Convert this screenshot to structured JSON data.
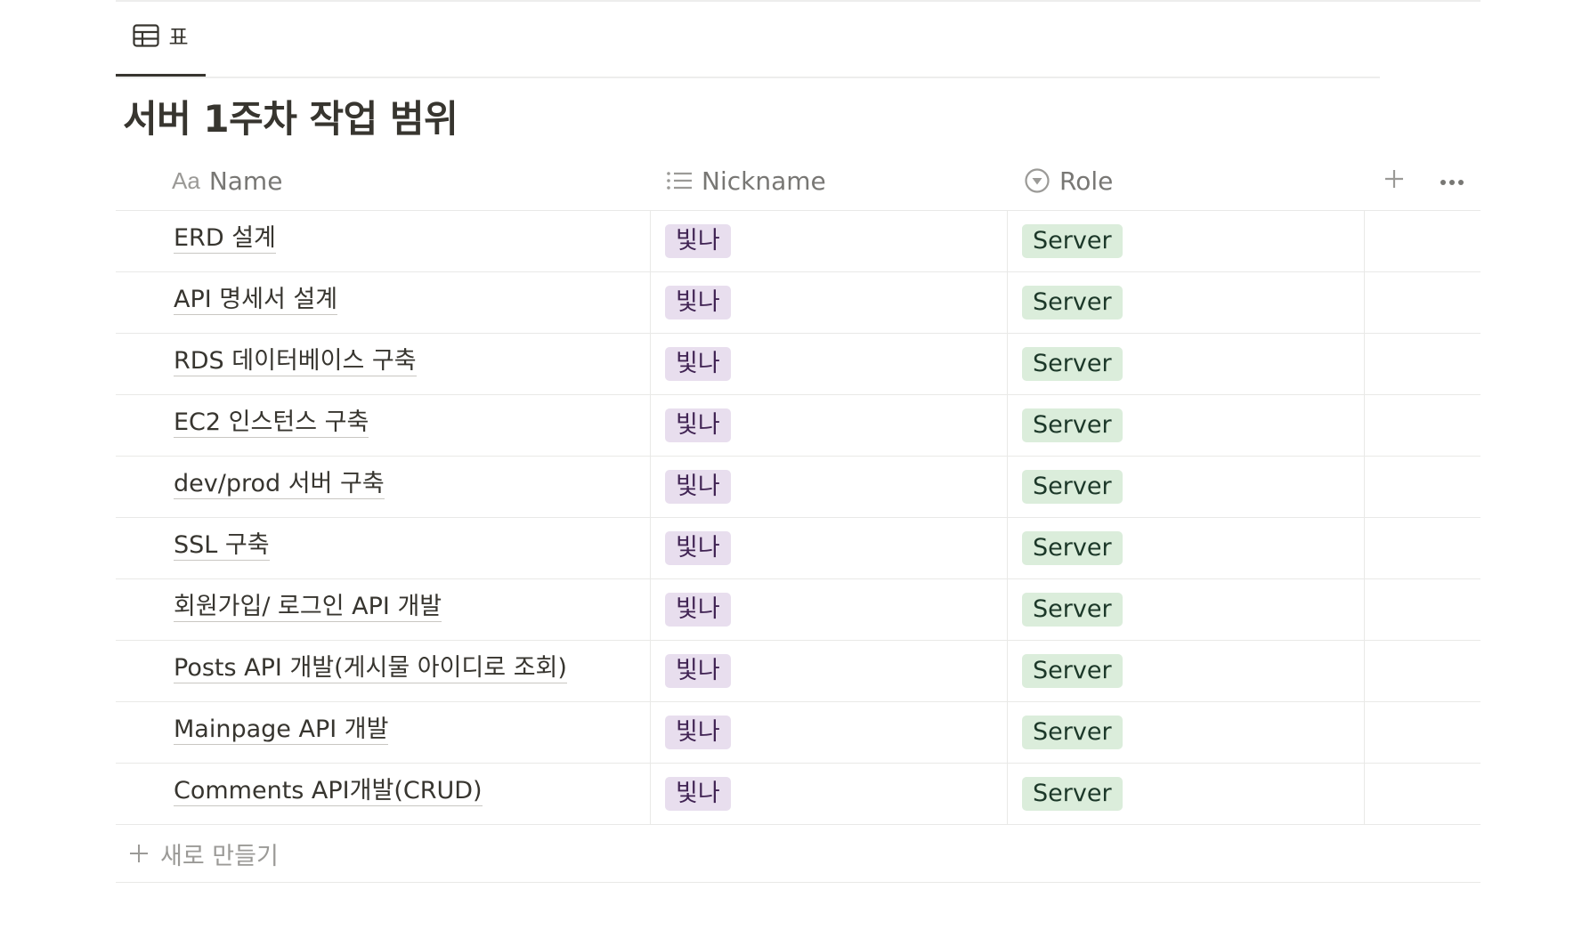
{
  "view": {
    "tab_label": "표",
    "tab_icon": "table-icon"
  },
  "page": {
    "title": "서버 1주차 작업 범위"
  },
  "table": {
    "columns": [
      {
        "label": "Name",
        "icon": "Aa"
      },
      {
        "label": "Nickname",
        "icon": "list-icon"
      },
      {
        "label": "Role",
        "icon": "select-icon"
      }
    ],
    "add_column_icon": "plus-icon",
    "more_icon": "more-icon",
    "rows": [
      {
        "name": "ERD 설계",
        "nickname": "빛나",
        "role": "Server"
      },
      {
        "name": "API 명세서 설계",
        "nickname": "빛나",
        "role": "Server"
      },
      {
        "name": "RDS 데이터베이스 구축",
        "nickname": "빛나",
        "role": "Server"
      },
      {
        "name": "EC2 인스턴스 구축",
        "nickname": "빛나",
        "role": "Server"
      },
      {
        "name": "dev/prod 서버 구축",
        "nickname": "빛나",
        "role": "Server"
      },
      {
        "name": "SSL 구축",
        "nickname": "빛나",
        "role": "Server"
      },
      {
        "name": "회원가입/ 로그인 API 개발",
        "nickname": "빛나",
        "role": "Server"
      },
      {
        "name": "Posts API 개발(게시물 아이디로 조회)",
        "nickname": "빛나",
        "role": "Server"
      },
      {
        "name": "Mainpage API 개발",
        "nickname": "빛나",
        "role": "Server"
      },
      {
        "name": "Comments API개발(CRUD)",
        "nickname": "빛나",
        "role": "Server"
      }
    ],
    "new_row_label": "새로 만들기"
  },
  "colors": {
    "text": "#37352f",
    "muted": "#9b9a97",
    "nickname_tag_bg": "#e8deee",
    "role_tag_bg": "#dbeddb"
  }
}
